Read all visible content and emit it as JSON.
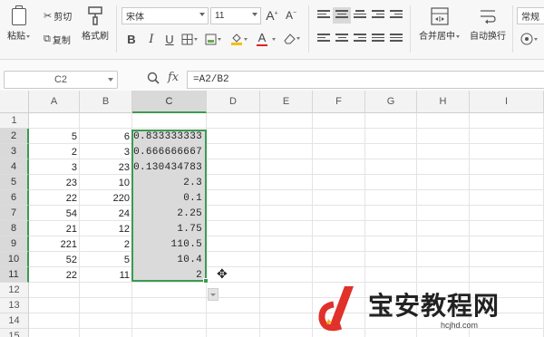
{
  "ribbon": {
    "paste_label": "粘贴",
    "cut_label": "剪切",
    "copy_label": "复制",
    "format_painter_label": "格式刷",
    "font_name": "宋体",
    "font_size": "11",
    "bold": "B",
    "italic": "I",
    "underline": "U",
    "font_color_glyph": "A",
    "merge_center_label": "合并居中",
    "wrap_text_label": "自动换行",
    "number_format": "常规",
    "increase_font_glyph": "A⁺",
    "decrease_font_glyph": "A⁻"
  },
  "formula_bar": {
    "name_box": "C2",
    "fx_label": "fx",
    "formula": "=A2/B2"
  },
  "sheet": {
    "columns": [
      "A",
      "B",
      "C",
      "D",
      "E",
      "F",
      "G",
      "H",
      "I"
    ],
    "rows": [
      "1",
      "2",
      "3",
      "4",
      "5",
      "6",
      "7",
      "8",
      "9",
      "10",
      "11",
      "12",
      "13",
      "14",
      "15"
    ],
    "selected_column": "C",
    "selected_range": "C2:C11",
    "data": [
      {
        "row": "2",
        "a": "5",
        "b": "6",
        "c": "0.833333333"
      },
      {
        "row": "3",
        "a": "2",
        "b": "3",
        "c": "0.666666667"
      },
      {
        "row": "4",
        "a": "3",
        "b": "23",
        "c": "0.130434783"
      },
      {
        "row": "5",
        "a": "23",
        "b": "10",
        "c": "2.3"
      },
      {
        "row": "6",
        "a": "22",
        "b": "220",
        "c": "0.1"
      },
      {
        "row": "7",
        "a": "54",
        "b": "24",
        "c": "2.25"
      },
      {
        "row": "8",
        "a": "21",
        "b": "12",
        "c": "1.75"
      },
      {
        "row": "9",
        "a": "221",
        "b": "2",
        "c": "110.5"
      },
      {
        "row": "10",
        "a": "52",
        "b": "5",
        "c": "10.4"
      },
      {
        "row": "11",
        "a": "22",
        "b": "11",
        "c": "2"
      }
    ]
  },
  "watermark": {
    "text": "宝安教程网",
    "url": "hcjhd.com"
  },
  "colors": {
    "selection_border": "#3c9a52",
    "selection_fill": "#dadada",
    "logo_red": "#e0312b"
  }
}
